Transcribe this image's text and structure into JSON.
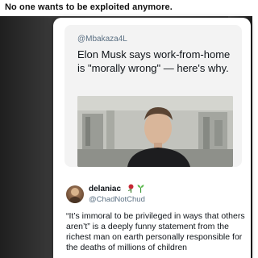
{
  "caption": "No one wants to be exploited anymore.",
  "quoted_post": {
    "handle": "@Mbakaza4L",
    "headline": "Elon Musk says work-from-home is \"morally wrong\" — here's why."
  },
  "reply": {
    "display_name": "delaniac",
    "emojis": [
      "rose-icon",
      "seedling-icon"
    ],
    "handle": "@ChadNotChud",
    "text": "“It’s immoral to be privileged in ways that others aren’t” is a deeply funny statement from the richest man on earth personally responsible for the deaths of millions of children"
  },
  "colors": {
    "text_primary": "#0f1419",
    "text_secondary": "#5b7083",
    "quote_background": "#f3f3f3"
  }
}
